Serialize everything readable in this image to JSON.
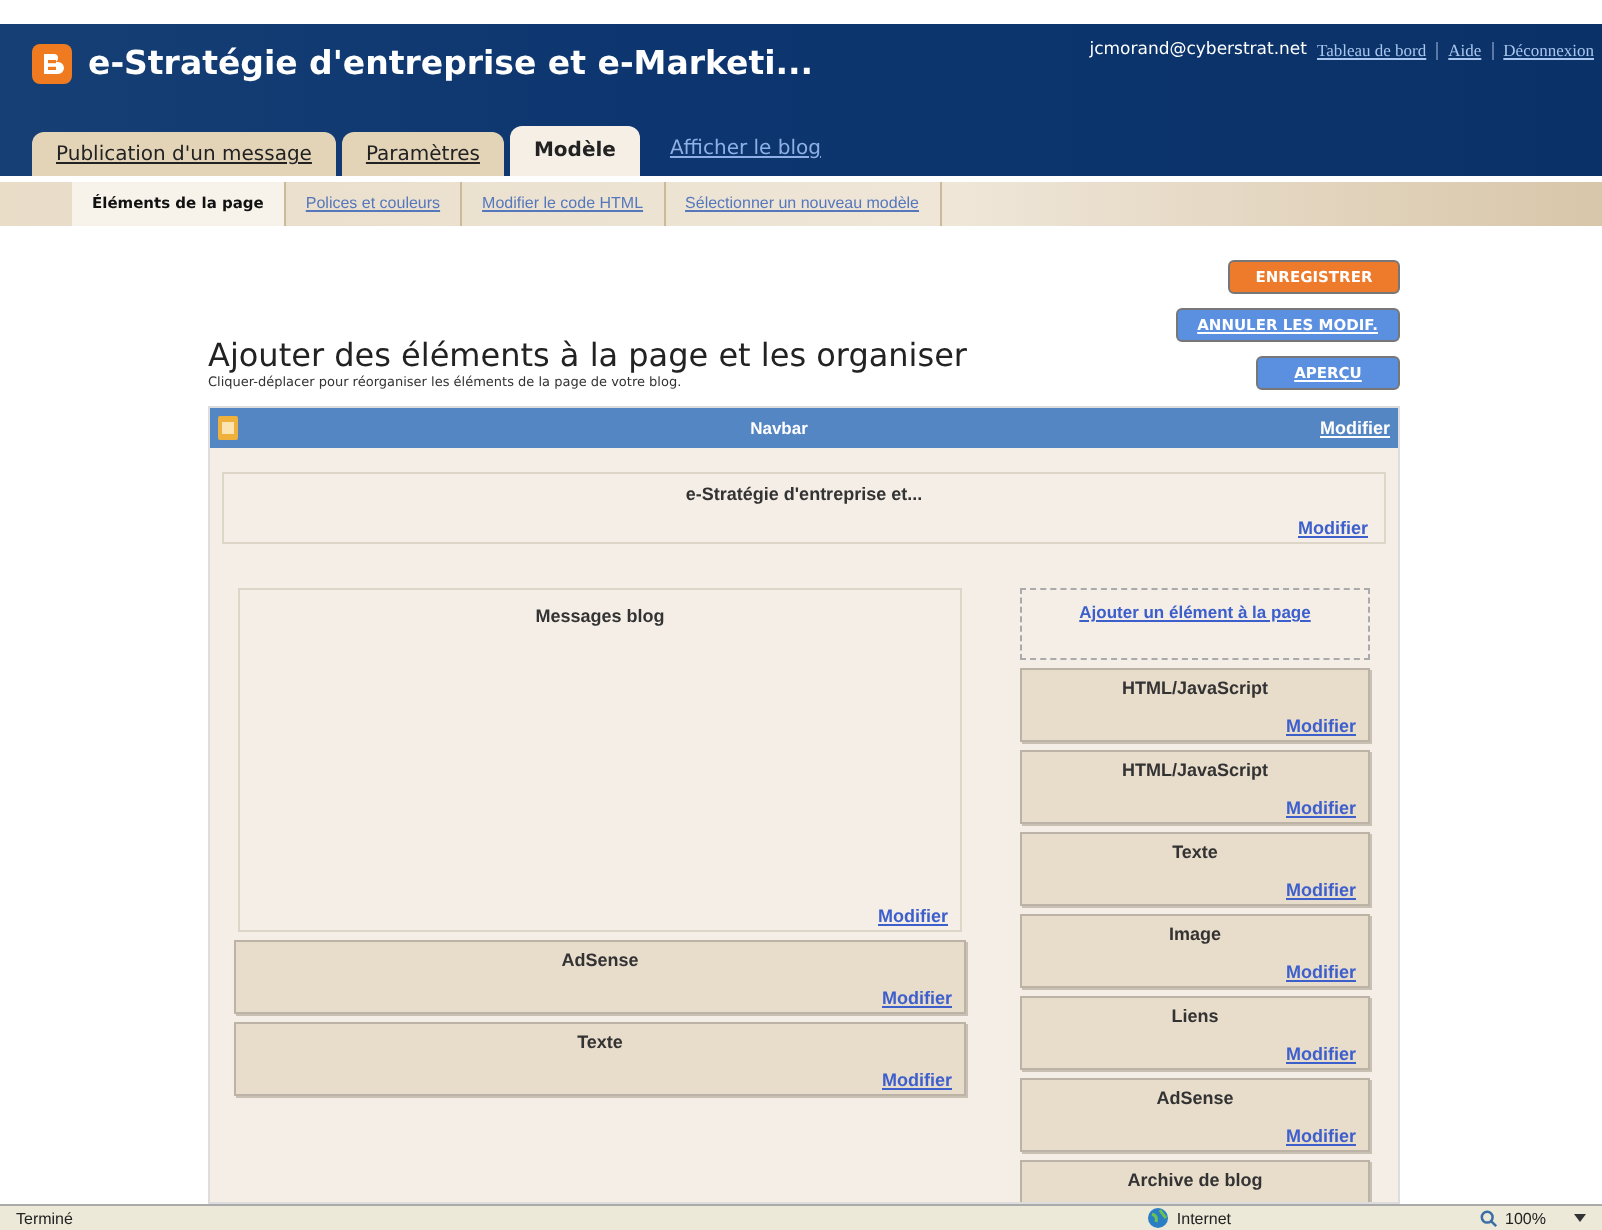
{
  "header": {
    "blog_title": "e-Stratégie d'entreprise et e-Marketi...",
    "account": "jcmorand@cyberstrat.net",
    "links": [
      "Tableau de bord",
      "Aide",
      "Déconnexion"
    ]
  },
  "tabs": [
    {
      "label": "Publication d'un message",
      "kind": "tab",
      "selected": false
    },
    {
      "label": "Paramètres",
      "kind": "tab",
      "selected": false
    },
    {
      "label": "Modèle",
      "kind": "tab",
      "selected": true
    },
    {
      "label": "Afficher le blog",
      "kind": "link",
      "selected": false
    }
  ],
  "subtabs": [
    {
      "label": "Éléments de la page",
      "selected": true
    },
    {
      "label": "Polices et couleurs",
      "selected": false
    },
    {
      "label": "Modifier le code HTML",
      "selected": false
    },
    {
      "label": "Sélectionner un nouveau modèle",
      "selected": false
    }
  ],
  "buttons": [
    {
      "label": "ENREGISTRER",
      "kind": "primary"
    },
    {
      "label": "ANNULER LES MODIF.",
      "kind": "secondary"
    },
    {
      "label": "APERÇU",
      "kind": "secondary"
    }
  ],
  "heading": "Ajouter des éléments à la page et les organiser",
  "subheading": "Cliquer-déplacer pour réorganiser les éléments de la page de votre blog.",
  "navbar": {
    "title": "Navbar",
    "link": "Modifier"
  },
  "blog_header": {
    "title": "e-Stratégie d'entreprise et...",
    "link": "Modifier"
  },
  "main_column": [
    {
      "kind": "posts",
      "title": "Messages blog",
      "link": "Modifier"
    },
    {
      "kind": "gadget",
      "title": "AdSense",
      "link": "Modifier"
    },
    {
      "kind": "gadget",
      "title": "Texte",
      "link": "Modifier"
    }
  ],
  "sidebar": {
    "add_link": "Ajouter un élément à la page",
    "items": [
      {
        "title": "HTML/JavaScript",
        "link": "Modifier"
      },
      {
        "title": "HTML/JavaScript",
        "link": "Modifier"
      },
      {
        "title": "Texte",
        "link": "Modifier"
      },
      {
        "title": "Image",
        "link": "Modifier"
      },
      {
        "title": "Liens",
        "link": "Modifier"
      },
      {
        "title": "AdSense",
        "link": "Modifier"
      },
      {
        "title": "Archive de blog"
      }
    ]
  },
  "status_bar": {
    "status": "Terminé",
    "zone": "Internet",
    "zoom": "100%"
  }
}
